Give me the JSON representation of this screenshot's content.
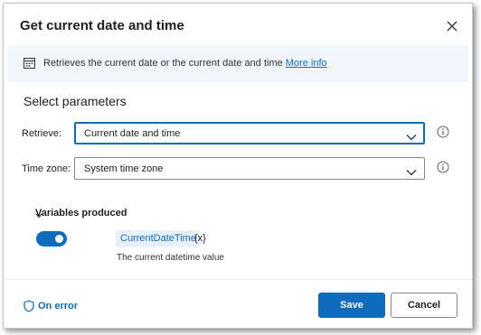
{
  "dialog": {
    "title": "Get current date and time",
    "close_icon": "close-icon"
  },
  "info_bar": {
    "icon": "calendar-icon",
    "text": "Retrieves the current date or the current date and time",
    "link_label": "More info"
  },
  "parameters": {
    "section_title": "Select parameters",
    "retrieve": {
      "label": "Retrieve:",
      "value": "Current date and time"
    },
    "time_zone": {
      "label": "Time zone:",
      "value": "System time zone"
    }
  },
  "variables": {
    "header": "Variables produced",
    "toggle_on": true,
    "name": "CurrentDateTime",
    "type_glyph": "{x}",
    "description": "The current datetime value"
  },
  "footer": {
    "on_error_label": "On error",
    "save_label": "Save",
    "cancel_label": "Cancel"
  },
  "colors": {
    "accent": "#0f6cbd",
    "info_bg": "#eff6fc",
    "chip_bg": "#e8f1fb"
  }
}
